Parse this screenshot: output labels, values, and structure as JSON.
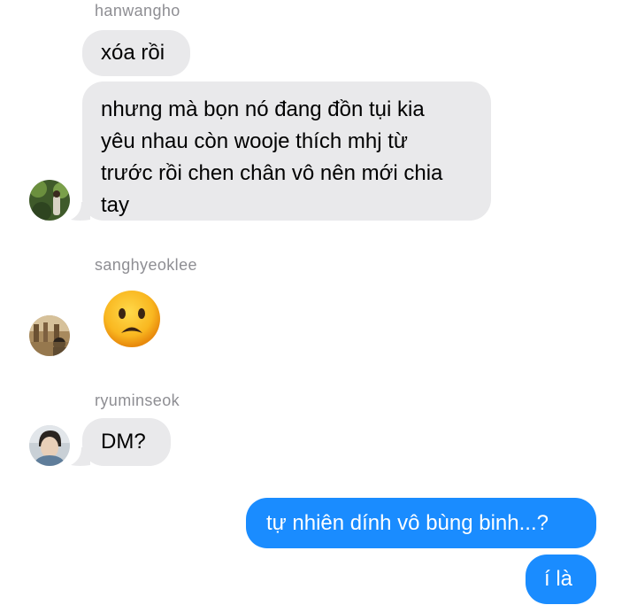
{
  "messages": [
    {
      "sender": "hanwangho",
      "bubbles": [
        "xóa rồi",
        "nhưng mà bọn nó đang đồn tụi kia yêu nhau còn wooje thích mhj từ trước rồi chen chân vô nên mới chia tay"
      ]
    },
    {
      "sender": "sanghyeoklee",
      "emoji": "worried-face"
    },
    {
      "sender": "ryuminseok",
      "bubbles": [
        "DM?"
      ]
    }
  ],
  "outgoing": [
    "tự nhiên dính vô bùng binh...?",
    "í là"
  ],
  "lines": {
    "hwh2": [
      "nhưng mà bọn nó đang đồn tụi kia",
      "yêu nhau còn wooje thích mhj từ",
      "trước rồi chen chân vô nên mới chia",
      "tay"
    ]
  },
  "colors": {
    "incoming_bubble": "#e9e9eb",
    "outgoing_bubble": "#1a8cff",
    "sender_name": "#8e8e93"
  }
}
